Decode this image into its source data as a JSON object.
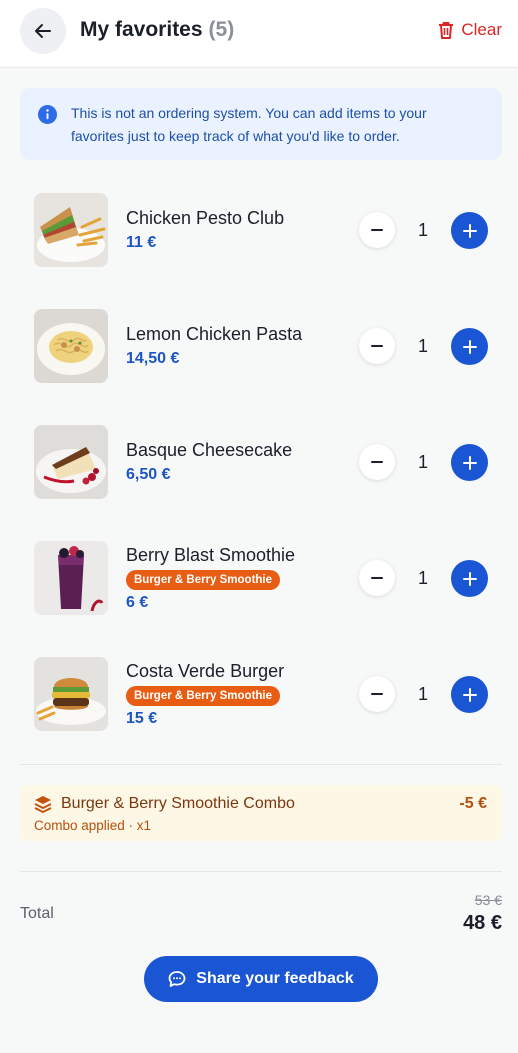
{
  "header": {
    "title": "My favorites",
    "count": "(5)",
    "clear_label": "Clear",
    "back_icon": "arrow-left-icon",
    "clear_icon": "trash-icon"
  },
  "notice": {
    "text": "This is not an ordering system. You can add items to your favorites just to keep track of what you'd like to order.",
    "icon": "info-icon"
  },
  "items": [
    {
      "name": "Chicken Pesto Club",
      "price": "11 €",
      "quantity": "1",
      "badge": null,
      "image": "chicken-pesto-club-sandwich-with-fries"
    },
    {
      "name": "Lemon Chicken Pasta",
      "price": "14,50 €",
      "quantity": "1",
      "badge": null,
      "image": "lemon-chicken-pasta-plate"
    },
    {
      "name": "Basque Cheesecake",
      "price": "6,50 €",
      "quantity": "1",
      "badge": null,
      "image": "basque-cheesecake-slice-with-berries"
    },
    {
      "name": "Berry Blast Smoothie",
      "price": "6 €",
      "quantity": "1",
      "badge": "Burger & Berry Smoothie",
      "image": "berry-smoothie-glass"
    },
    {
      "name": "Costa Verde Burger",
      "price": "15 €",
      "quantity": "1",
      "badge": "Burger & Berry Smoothie",
      "image": "burger-with-fries"
    }
  ],
  "combo": {
    "title": "Burger & Berry Smoothie Combo",
    "subtitle": "Combo applied · x1",
    "discount": "-5 €",
    "icon": "layers-icon"
  },
  "totals": {
    "label": "Total",
    "original": "53 €",
    "final": "48 €"
  },
  "feedback": {
    "label": "Share your feedback",
    "icon": "chat-bubble-icon"
  },
  "colors": {
    "accent": "#1a56d3",
    "price": "#1d56c4",
    "danger": "#dc2626",
    "badge": "#e85d14",
    "info_background": "#e9f2fe",
    "combo_background": "#fdf7e6"
  }
}
